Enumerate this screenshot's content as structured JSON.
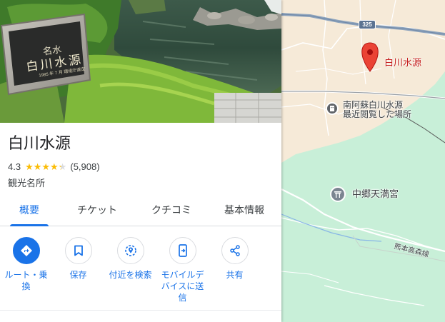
{
  "place": {
    "name": "白川水源",
    "rating": "4.3",
    "rating_value": 4.3,
    "review_count": "(5,908)",
    "category": "観光名所"
  },
  "photo": {
    "monument_main": "白川水源",
    "monument_top": "名水",
    "monument_sub": "1985 年 7 月 環境庁選定"
  },
  "tabs": [
    {
      "label": "概要",
      "active": true
    },
    {
      "label": "チケット",
      "active": false
    },
    {
      "label": "クチコミ",
      "active": false
    },
    {
      "label": "基本情報",
      "active": false
    }
  ],
  "actions": [
    {
      "label": "ルート・乗換",
      "icon": "directions-icon"
    },
    {
      "label": "保存",
      "icon": "bookmark-icon"
    },
    {
      "label": "付近を検索",
      "icon": "nearby-icon"
    },
    {
      "label": "モバイルデバイスに送信",
      "icon": "send-to-phone-icon"
    },
    {
      "label": "共有",
      "icon": "share-icon"
    }
  ],
  "map": {
    "route_shield": "325",
    "pin_label": "白川水源",
    "poi_1_line1": "南阿蘇白川水源",
    "poi_1_line2": "最近閲覧した場所",
    "poi_2": "中郷天満宮",
    "railway": "熊本高森線"
  },
  "colors": {
    "accent": "#1a73e8",
    "star": "#fbbc04",
    "pin": "#ea4335",
    "map_land": "#f5e8d6",
    "map_green": "#c9f0d9"
  }
}
